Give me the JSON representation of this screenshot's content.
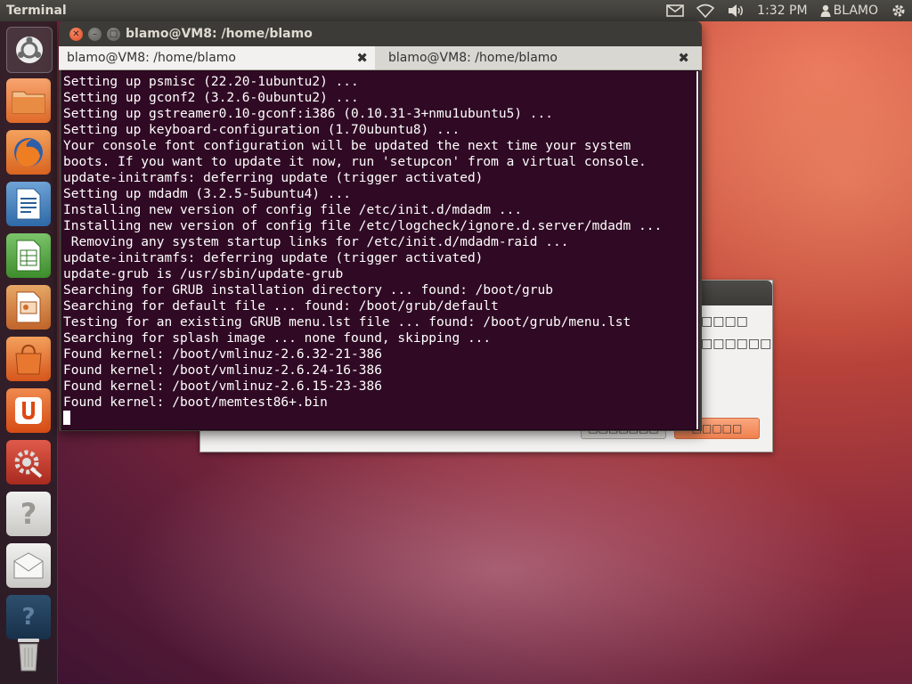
{
  "top_panel": {
    "app_title": "Terminal",
    "clock": "1:32 PM",
    "user": "BLAMO",
    "icons": [
      "mail-icon",
      "wifi-icon",
      "volume-icon",
      "user-icon",
      "gear-icon"
    ]
  },
  "launcher": {
    "items": [
      "dash-home",
      "home-folder",
      "firefox",
      "libreoffice-writer",
      "libreoffice-calc",
      "libreoffice-impress",
      "ubuntu-software-center",
      "ubuntu-one",
      "system-settings",
      "help",
      "mail-installer",
      "workspace-switcher",
      "trash"
    ]
  },
  "background_dialog": {
    "text_line1": "□□□□",
    "text_line2": "□□□□□□",
    "button_secondary": "□□□□□□□",
    "button_primary": "□□□□□"
  },
  "terminal": {
    "window_title": "blamo@VM8: /home/blamo",
    "tabs": [
      {
        "label": "blamo@VM8: /home/blamo",
        "close": "✖"
      },
      {
        "label": "blamo@VM8: /home/blamo",
        "close": "✖"
      }
    ],
    "lines": [
      "Setting up psmisc (22.20-1ubuntu2) ...",
      "Setting up gconf2 (3.2.6-0ubuntu2) ...",
      "Setting up gstreamer0.10-gconf:i386 (0.10.31-3+nmu1ubuntu5) ...",
      "Setting up keyboard-configuration (1.70ubuntu8) ...",
      "Your console font configuration will be updated the next time your system",
      "boots. If you want to update it now, run 'setupcon' from a virtual console.",
      "update-initramfs: deferring update (trigger activated)",
      "Setting up mdadm (3.2.5-5ubuntu4) ...",
      "Installing new version of config file /etc/init.d/mdadm ...",
      "Installing new version of config file /etc/logcheck/ignore.d.server/mdadm ...",
      " Removing any system startup links for /etc/init.d/mdadm-raid ...",
      "update-initramfs: deferring update (trigger activated)",
      "update-grub is /usr/sbin/update-grub",
      "Searching for GRUB installation directory ... found: /boot/grub",
      "Searching for default file ... found: /boot/grub/default",
      "Testing for an existing GRUB menu.lst file ... found: /boot/grub/menu.lst",
      "Searching for splash image ... none found, skipping ...",
      "Found kernel: /boot/vmlinuz-2.6.32-21-386",
      "Found kernel: /boot/vmlinuz-2.6.24-16-386",
      "Found kernel: /boot/vmlinuz-2.6.15-23-386",
      "Found kernel: /boot/memtest86+.bin"
    ]
  }
}
